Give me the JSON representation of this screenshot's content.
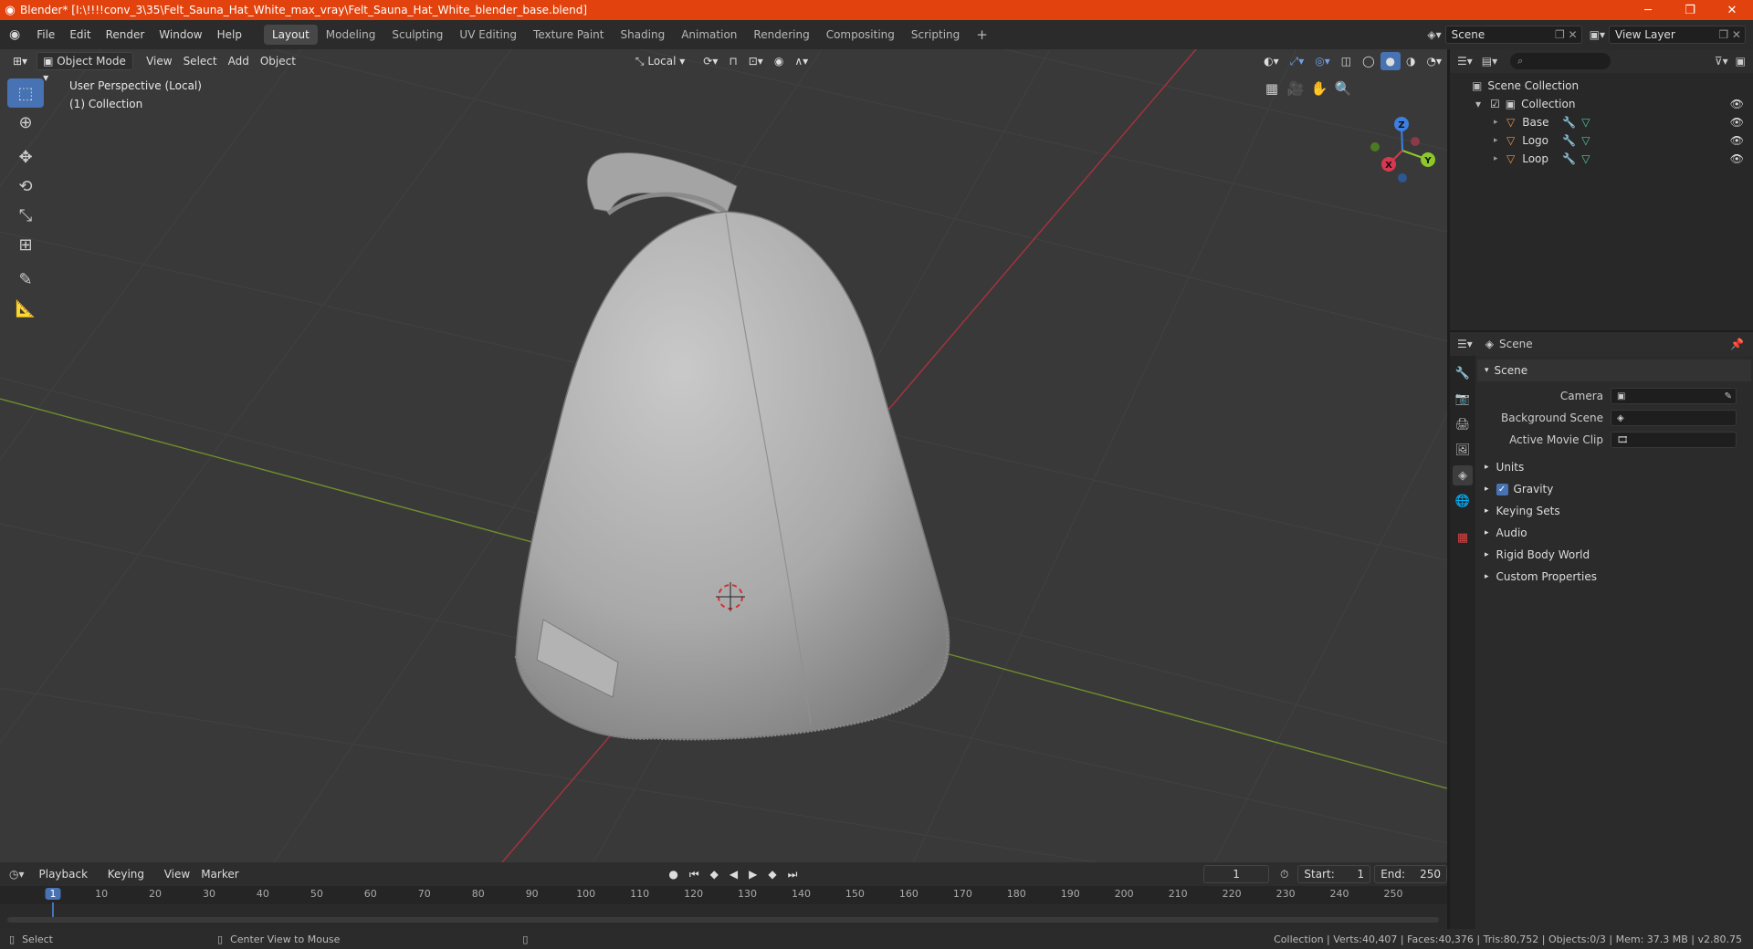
{
  "titlebar": {
    "title": "Blender* [I:\\!!!!conv_3\\35\\Felt_Sauna_Hat_White_max_vray\\Felt_Sauna_Hat_White_blender_base.blend]"
  },
  "menu": [
    "File",
    "Edit",
    "Render",
    "Window",
    "Help"
  ],
  "workspaces": [
    "Layout",
    "Modeling",
    "Sculpting",
    "UV Editing",
    "Texture Paint",
    "Shading",
    "Animation",
    "Rendering",
    "Compositing",
    "Scripting"
  ],
  "scene_name": "Scene",
  "view_layer": "View Layer",
  "viewport": {
    "mode": "Object Mode",
    "menus": [
      "View",
      "Select",
      "Add",
      "Object"
    ],
    "transform_orientation": "Local",
    "info_line1": "User Perspective (Local)",
    "info_line2": "(1) Collection",
    "gizmo": {
      "x": "X",
      "y": "Y",
      "z": "Z"
    }
  },
  "outliner": {
    "root": "Scene Collection",
    "collection": "Collection",
    "objects": [
      "Base",
      "Logo",
      "Loop"
    ]
  },
  "properties": {
    "header": "Scene",
    "panel": "Scene",
    "fields": [
      {
        "label": "Camera"
      },
      {
        "label": "Background Scene"
      },
      {
        "label": "Active Movie Clip"
      }
    ],
    "sections": [
      "Units",
      "Gravity",
      "Keying Sets",
      "Audio",
      "Rigid Body World",
      "Custom Properties"
    ]
  },
  "timeline": {
    "menus": [
      "Playback",
      "Keying",
      "View",
      "Marker"
    ],
    "current_frame": "1",
    "start_label": "Start:",
    "start": "1",
    "end_label": "End:",
    "end": "250",
    "ticks": [
      "1",
      "10",
      "20",
      "30",
      "40",
      "50",
      "60",
      "70",
      "80",
      "90",
      "100",
      "110",
      "120",
      "130",
      "140",
      "150",
      "160",
      "170",
      "180",
      "190",
      "200",
      "210",
      "220",
      "230",
      "240",
      "250"
    ]
  },
  "status": {
    "left_action": "Select",
    "mid_action": "Center View to Mouse",
    "stats": "Collection | Verts:40,407 | Faces:40,376 | Tris:80,752 | Objects:0/3 | Mem: 37.3 MB | v2.80.75"
  },
  "colors": {
    "accent": "#4772b3",
    "titlebar": "#e2420d",
    "x_axis": "#d8384f",
    "y_axis": "#8cc72b",
    "z_axis": "#3d7fe0"
  }
}
